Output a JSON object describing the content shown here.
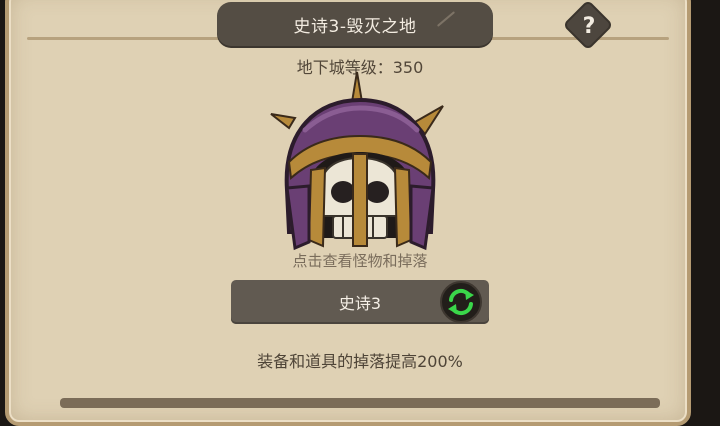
{
  "title": "史诗3-毁灭之地",
  "help_icon": "question-mark-icon",
  "help_label": "?",
  "dungeon_level": "地下城等级：350",
  "boss_icon": "skull-helmet-icon",
  "hint": "点击查看怪物和掉落",
  "difficulty": {
    "label": "史诗3",
    "switch_icon": "swap-arrows-icon"
  },
  "bonus_text": "装备和道具的掉落提高200%",
  "colors": {
    "panel": "#dfd1b4",
    "banner": "#544d44",
    "helmet_purple": "#6a3f74",
    "helmet_gold": "#b78a3a",
    "swap_green": "#3ad64a"
  }
}
